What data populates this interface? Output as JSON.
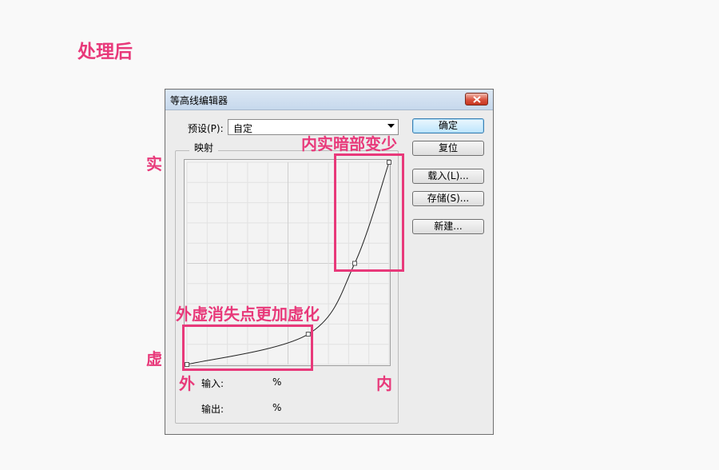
{
  "heading": "处理后",
  "dialog": {
    "title": "等高线编辑器",
    "preset": {
      "label": "预设(P):",
      "value": "自定"
    },
    "group_title": "映射",
    "input_label": "输入:",
    "input_value": "%",
    "output_label": "输出:",
    "output_value": "%",
    "buttons": {
      "ok": "确定",
      "reset": "复位",
      "load": "载入(L)...",
      "save": "存储(S)...",
      "new": "新建..."
    }
  },
  "annotations": {
    "top_note": "内实暗部变少",
    "bottom_note": "外虚消失点更加虚化",
    "side_top": "实",
    "side_bottom": "虚",
    "axis_left": "外",
    "axis_right": "内"
  },
  "colors": {
    "accent": "#e8397a",
    "dialog_bg": "#ececec"
  },
  "curve": {
    "points": [
      [
        0,
        0
      ],
      [
        60,
        15
      ],
      [
        83,
        50
      ],
      [
        100,
        100
      ]
    ]
  }
}
